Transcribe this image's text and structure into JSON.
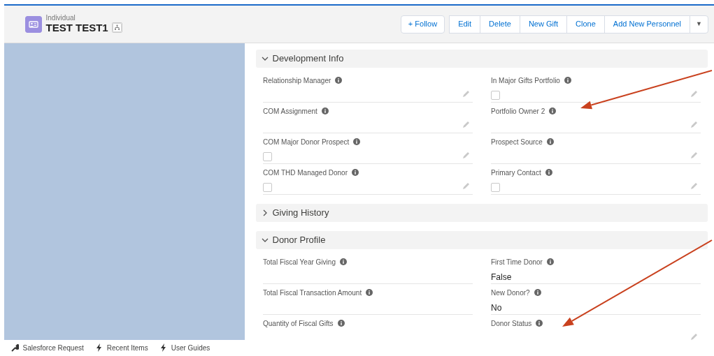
{
  "header": {
    "object_type": "Individual",
    "record_name": "TEST TEST1"
  },
  "actions": [
    {
      "label": "+ Follow",
      "kind": "follow"
    },
    {
      "label": "Edit",
      "kind": "group"
    },
    {
      "label": "Delete",
      "kind": "group"
    },
    {
      "label": "New Gift",
      "kind": "group"
    },
    {
      "label": "Clone",
      "kind": "group"
    },
    {
      "label": "Add New Personnel",
      "kind": "group"
    },
    {
      "label": "▼",
      "kind": "menu"
    }
  ],
  "sections": [
    {
      "title": "Development Info",
      "expanded": true,
      "fields": [
        {
          "label": "Relationship Manager",
          "kind": "text",
          "editable": true
        },
        {
          "label": "In Major Gifts Portfolio",
          "kind": "checkbox",
          "checked": false,
          "editable": true
        },
        {
          "label": "COM Assignment",
          "kind": "text",
          "editable": true
        },
        {
          "label": "Portfolio Owner 2",
          "kind": "text",
          "editable": true
        },
        {
          "label": "COM Major Donor Prospect",
          "kind": "checkbox",
          "checked": false,
          "editable": true
        },
        {
          "label": "Prospect Source",
          "kind": "text",
          "editable": true
        },
        {
          "label": "COM THD Managed Donor",
          "kind": "checkbox",
          "checked": false,
          "editable": true
        },
        {
          "label": "Primary Contact",
          "kind": "checkbox",
          "checked": false,
          "editable": true
        }
      ]
    },
    {
      "title": "Giving History",
      "expanded": false
    },
    {
      "title": "Donor Profile",
      "expanded": true,
      "fields": [
        {
          "label": "Total Fiscal Year Giving",
          "kind": "text",
          "editable": false
        },
        {
          "label": "First Time Donor",
          "kind": "text",
          "value": "False",
          "editable": false
        },
        {
          "label": "Total Fiscal Transaction Amount",
          "kind": "text",
          "editable": false
        },
        {
          "label": "New Donor?",
          "kind": "text",
          "value": "No",
          "editable": false
        },
        {
          "label": "Quantity of Fiscal Gifts",
          "kind": "text",
          "editable": false
        },
        {
          "label": "Donor Status",
          "kind": "text",
          "editable": true
        }
      ]
    }
  ],
  "annotations": [
    {
      "kind": "arrow"
    },
    {
      "kind": "arrow"
    }
  ],
  "utility_bar": [
    {
      "label": "Salesforce Request",
      "kind": "wrench"
    },
    {
      "label": "Recent Items",
      "kind": "bolt"
    },
    {
      "label": "User Guides",
      "kind": "bolt"
    }
  ]
}
